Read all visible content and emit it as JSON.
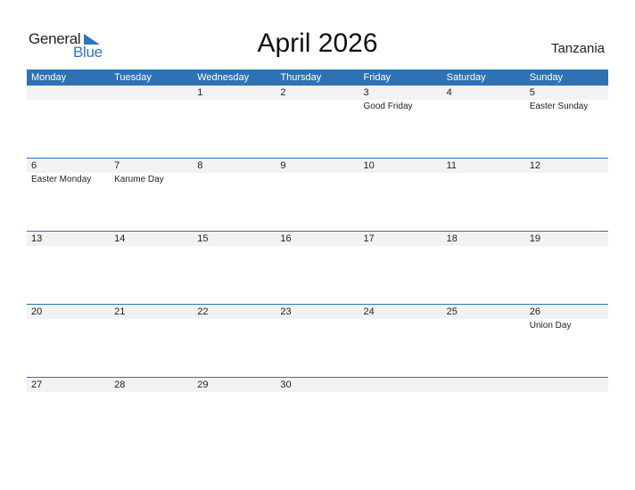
{
  "logo": {
    "general": "General",
    "blue": "Blue",
    "icon": "triangle-flag-icon"
  },
  "title": "April 2026",
  "country": "Tanzania",
  "colors": {
    "accent": "#2e72b3",
    "band": "#f2f2f2",
    "logo_blue": "#2c76c1"
  },
  "weekdays": [
    "Monday",
    "Tuesday",
    "Wednesday",
    "Thursday",
    "Friday",
    "Saturday",
    "Sunday"
  ],
  "weeks": [
    {
      "days": [
        {
          "num": "",
          "holiday": ""
        },
        {
          "num": "",
          "holiday": ""
        },
        {
          "num": "1",
          "holiday": ""
        },
        {
          "num": "2",
          "holiday": ""
        },
        {
          "num": "3",
          "holiday": "Good Friday"
        },
        {
          "num": "4",
          "holiday": ""
        },
        {
          "num": "5",
          "holiday": "Easter Sunday"
        }
      ]
    },
    {
      "days": [
        {
          "num": "6",
          "holiday": "Easter Monday"
        },
        {
          "num": "7",
          "holiday": "Karume Day"
        },
        {
          "num": "8",
          "holiday": ""
        },
        {
          "num": "9",
          "holiday": ""
        },
        {
          "num": "10",
          "holiday": ""
        },
        {
          "num": "11",
          "holiday": ""
        },
        {
          "num": "12",
          "holiday": ""
        }
      ]
    },
    {
      "days": [
        {
          "num": "13",
          "holiday": ""
        },
        {
          "num": "14",
          "holiday": ""
        },
        {
          "num": "15",
          "holiday": ""
        },
        {
          "num": "16",
          "holiday": ""
        },
        {
          "num": "17",
          "holiday": ""
        },
        {
          "num": "18",
          "holiday": ""
        },
        {
          "num": "19",
          "holiday": ""
        }
      ]
    },
    {
      "days": [
        {
          "num": "20",
          "holiday": ""
        },
        {
          "num": "21",
          "holiday": ""
        },
        {
          "num": "22",
          "holiday": ""
        },
        {
          "num": "23",
          "holiday": ""
        },
        {
          "num": "24",
          "holiday": ""
        },
        {
          "num": "25",
          "holiday": ""
        },
        {
          "num": "26",
          "holiday": "Union Day"
        }
      ]
    },
    {
      "days": [
        {
          "num": "27",
          "holiday": ""
        },
        {
          "num": "28",
          "holiday": ""
        },
        {
          "num": "29",
          "holiday": ""
        },
        {
          "num": "30",
          "holiday": ""
        },
        {
          "num": "",
          "holiday": ""
        },
        {
          "num": "",
          "holiday": ""
        },
        {
          "num": "",
          "holiday": ""
        }
      ]
    }
  ]
}
